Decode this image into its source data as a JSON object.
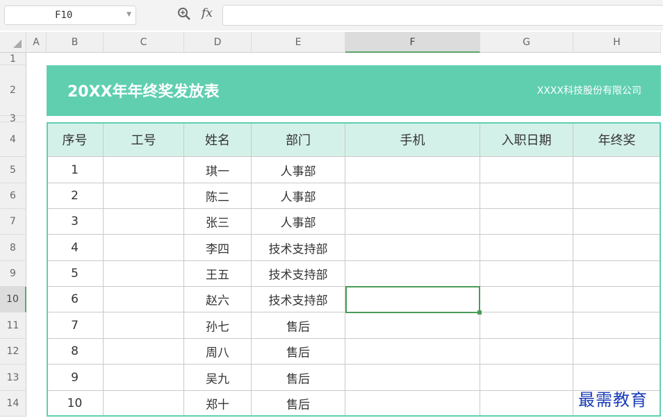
{
  "formula_bar": {
    "cell_ref": "F10",
    "fx_label": "fx",
    "formula_value": ""
  },
  "columns": [
    "A",
    "B",
    "C",
    "D",
    "E",
    "F",
    "G",
    "H"
  ],
  "rows": [
    "1",
    "2",
    "3",
    "4",
    "5",
    "6",
    "7",
    "8",
    "9",
    "10",
    "11",
    "12",
    "13",
    "14"
  ],
  "selected_column": "F",
  "selected_row": "10",
  "sheet": {
    "title": "20XX年年终奖发放表",
    "company": "XXXX科技股份有限公司",
    "headers": [
      "序号",
      "工号",
      "姓名",
      "部门",
      "手机",
      "入职日期",
      "年终奖"
    ],
    "data": [
      [
        "1",
        "",
        "琪一",
        "人事部",
        "",
        "",
        ""
      ],
      [
        "2",
        "",
        "陈二",
        "人事部",
        "",
        "",
        ""
      ],
      [
        "3",
        "",
        "张三",
        "人事部",
        "",
        "",
        ""
      ],
      [
        "4",
        "",
        "李四",
        "技术支持部",
        "",
        "",
        ""
      ],
      [
        "5",
        "",
        "王五",
        "技术支持部",
        "",
        "",
        ""
      ],
      [
        "6",
        "",
        "赵六",
        "技术支持部",
        "",
        "",
        ""
      ],
      [
        "7",
        "",
        "孙七",
        "售后",
        "",
        "",
        ""
      ],
      [
        "8",
        "",
        "周八",
        "售后",
        "",
        "",
        ""
      ],
      [
        "9",
        "",
        "吴九",
        "售后",
        "",
        "",
        ""
      ],
      [
        "10",
        "",
        "郑十",
        "售后",
        "",
        "",
        ""
      ]
    ]
  },
  "watermark": "最需教育",
  "colors": {
    "accent": "#5fcfb0",
    "header_fill": "#d4f1e9",
    "selection": "#4a9a57"
  }
}
